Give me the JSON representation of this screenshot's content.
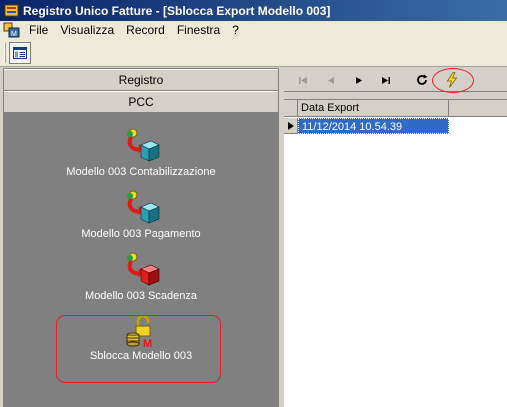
{
  "window": {
    "title": "Registro Unico Fatture - [Sblocca Export Modello 003]"
  },
  "menu": {
    "items": [
      "File",
      "Visualizza",
      "Record",
      "Finestra",
      "?"
    ]
  },
  "sidebar": {
    "groups": [
      "Registro",
      "PCC"
    ],
    "shortcuts": [
      {
        "label": "Modello 003 Contabilizzazione",
        "icon": "cube-teal-icon"
      },
      {
        "label": "Modello 003 Pagamento",
        "icon": "cube-teal-icon"
      },
      {
        "label": "Modello 003 Scadenza",
        "icon": "cube-red-icon"
      },
      {
        "label": "Sblocca Modello 003",
        "icon": "unlock-database-icon"
      }
    ]
  },
  "navigator": {
    "buttons": [
      "first",
      "prior",
      "next",
      "last",
      "refresh",
      "execute"
    ]
  },
  "grid": {
    "columns": [
      "Data Export"
    ],
    "rows": [
      [
        "11/12/2014 10.54.39"
      ]
    ]
  },
  "colors": {
    "title_bar": "#0a246a",
    "selection": "#316ac5",
    "highlight": "#e0202a",
    "panel_body": "#808080"
  }
}
